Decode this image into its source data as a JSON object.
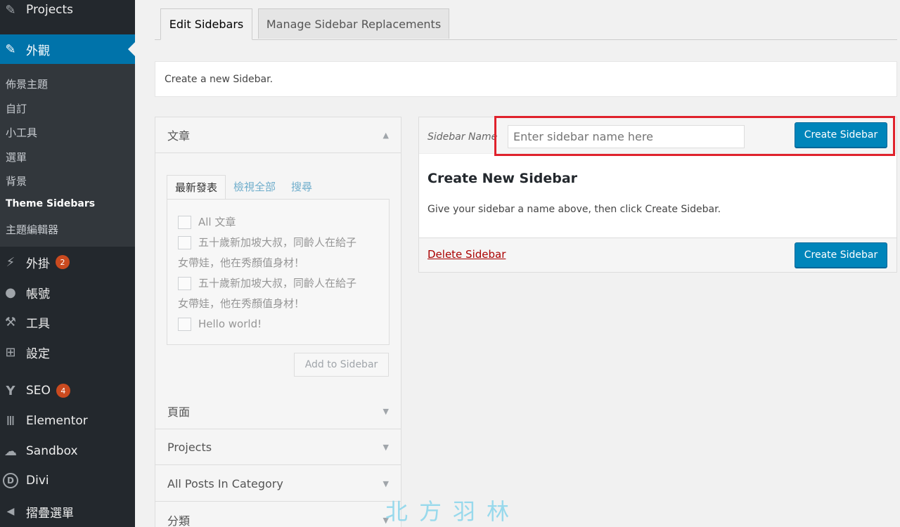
{
  "sidebar": {
    "menu": [
      {
        "label": "Projects",
        "icon": "pin-icon",
        "glyph": "✎"
      },
      {
        "label": "外觀",
        "icon": "paintbrush-icon",
        "glyph": "✎",
        "current": true
      },
      {
        "label": "外掛",
        "icon": "plugin-icon",
        "glyph": "⚡",
        "badge": "2"
      },
      {
        "label": "帳號",
        "icon": "user-icon",
        "glyph": "●"
      },
      {
        "label": "工具",
        "icon": "wrench-icon",
        "glyph": "⚒"
      },
      {
        "label": "設定",
        "icon": "settings-icon",
        "glyph": "⊞"
      },
      {
        "label": "SEO",
        "icon": "yoast-icon",
        "glyph": "Y",
        "badge": "4"
      },
      {
        "label": "Elementor",
        "icon": "elementor-icon",
        "glyph": "Ⅲ"
      },
      {
        "label": "Sandbox",
        "icon": "cloud-icon",
        "glyph": "☁"
      },
      {
        "label": "Divi",
        "icon": "divi-icon",
        "glyph": "D"
      },
      {
        "label": "摺疊選單",
        "icon": "collapse-icon",
        "glyph": "◀"
      }
    ],
    "submenu": [
      "佈景主題",
      "自訂",
      "小工具",
      "選單",
      "背景",
      "Theme Sidebars",
      "主題編輯器"
    ]
  },
  "tabs": {
    "edit": "Edit Sidebars",
    "manage": "Manage Sidebar Replacements"
  },
  "notice": "Create a new Sidebar.",
  "accordion": {
    "sections": [
      "文章",
      "頁面",
      "Projects",
      "All Posts In Category",
      "分類"
    ],
    "subtabs": [
      "最新發表",
      "檢視全部",
      "搜尋"
    ],
    "items": [
      "All 文章",
      "五十歲新加坡大叔，同齡人在給子",
      "女帶娃，他在秀顏值身材！",
      "五十歲新加坡大叔，同齡人在給子",
      "女帶娃，他在秀顏值身材！",
      "Hello world!"
    ],
    "add_button": "Add to Sidebar"
  },
  "panel": {
    "name_label": "Sidebar Name",
    "name_placeholder": "Enter sidebar name here",
    "create_button": "Create Sidebar",
    "title": "Create New Sidebar",
    "description": "Give your sidebar a name above, then click Create Sidebar.",
    "delete_link": "Delete Sidebar"
  },
  "watermark": "北方羽林",
  "colors": {
    "sidebar_bg": "#23282d",
    "accent": "#0073aa",
    "button": "#0085ba",
    "highlight_box": "#e0222c",
    "badge": "#ca4a1f"
  }
}
